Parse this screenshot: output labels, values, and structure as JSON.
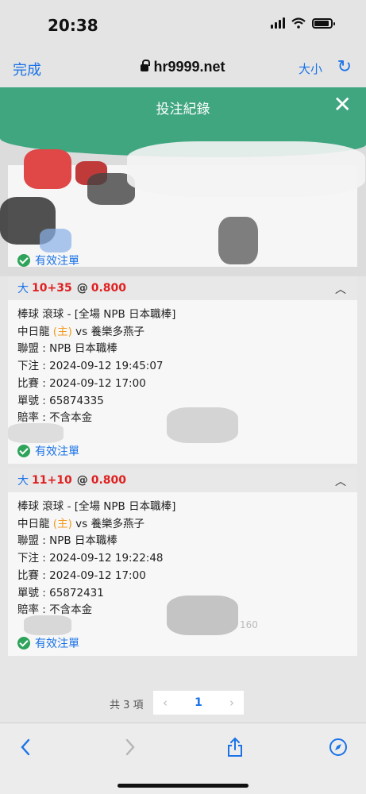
{
  "status_bar": {
    "time": "20:38"
  },
  "browser": {
    "done_label": "完成",
    "url": "hr9999.net",
    "text_size_label": "大小",
    "reload_icon": "reload-icon"
  },
  "header": {
    "title": "投注紀錄",
    "close_icon": "close-icon"
  },
  "first_record": {
    "status": "有效注單"
  },
  "records": [
    {
      "bet_type": "大",
      "score": "10+35",
      "at": "@",
      "odds": "0.800",
      "line1": "棒球 滾球 - [全場 NPB 日本職棒]",
      "home_team": "中日龍",
      "home_marker": "(主)",
      "vs_away": "vs 養樂多燕子",
      "league": "聯盟 : NPB 日本職棒",
      "bet_time": "下注 : 2024-09-12 19:45:07",
      "match_time": "比賽 : 2024-09-12 17:00",
      "ticket": "單號 : 65874335",
      "payout": "賠率 : 不含本金",
      "status": "有效注單"
    },
    {
      "bet_type": "大",
      "score": "11+10",
      "at": "@",
      "odds": "0.800",
      "line1": "棒球 滾球 - [全場 NPB 日本職棒]",
      "home_team": "中日龍",
      "home_marker": "(主)",
      "vs_away": "vs 養樂多燕子",
      "league": "聯盟 : NPB 日本職棒",
      "bet_time": "下注 : 2024-09-12 19:22:48",
      "match_time": "比賽 : 2024-09-12 17:00",
      "ticket": "單號 : 65872431",
      "payout": "賠率 : 不含本金",
      "status": "有效注單",
      "faint_amount": "160"
    }
  ],
  "pagination": {
    "total": "共 3 項",
    "prev": "‹",
    "current": "1",
    "next": "›"
  },
  "colors": {
    "header_green": "#3fa680",
    "link_blue": "#1a73e8",
    "score_red": "#e02020",
    "home_orange": "#f39a1e"
  }
}
